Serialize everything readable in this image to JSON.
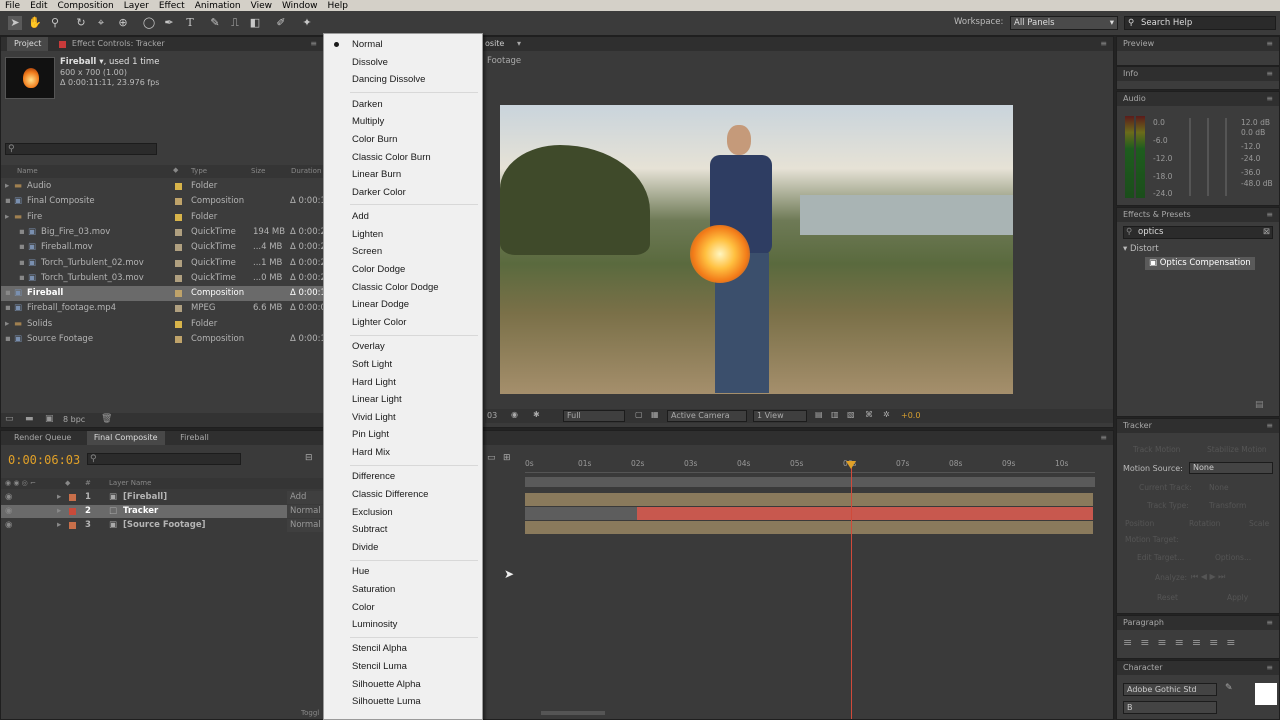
{
  "menubar": {
    "items": [
      "File",
      "Edit",
      "Composition",
      "Layer",
      "Effect",
      "Animation",
      "View",
      "Window",
      "Help"
    ]
  },
  "toolbar": {
    "workspace_label": "Workspace:",
    "workspace_value": "All Panels",
    "search_placeholder": "Search Help"
  },
  "project": {
    "tabs": [
      "Project",
      "Effect Controls: Tracker"
    ],
    "item_name": "Fireball ▾",
    "item_used": ", used 1 time",
    "item_dims": "600 x 700 (1.00)",
    "item_duration": "Δ 0:00:11:11, 23.976 fps",
    "columns": [
      "Name",
      "Type",
      "Size",
      "Duration"
    ],
    "bpc": "8 bpc",
    "rows": [
      {
        "name": "Audio",
        "type": "Folder",
        "size": "",
        "dur": "",
        "color": "#d8b44a",
        "indent": 0
      },
      {
        "name": "Final Composite",
        "type": "Composition",
        "size": "",
        "dur": "Δ 0:00:1",
        "color": "#bfa36a",
        "indent": 0
      },
      {
        "name": "Fire",
        "type": "Folder",
        "size": "",
        "dur": "",
        "color": "#d8b44a",
        "indent": 0
      },
      {
        "name": "Big_Fire_03.mov",
        "type": "QuickTime",
        "size": "194 MB",
        "dur": "Δ 0:00:2",
        "color": "#b0a080",
        "indent": 1
      },
      {
        "name": "Fireball.mov",
        "type": "QuickTime",
        "size": "...4 MB",
        "dur": "Δ 0:00:2",
        "color": "#b0a080",
        "indent": 1
      },
      {
        "name": "Torch_Turbulent_02.mov",
        "type": "QuickTime",
        "size": "...1 MB",
        "dur": "Δ 0:00:2",
        "color": "#b0a080",
        "indent": 1
      },
      {
        "name": "Torch_Turbulent_03.mov",
        "type": "QuickTime",
        "size": "...0 MB",
        "dur": "Δ 0:00:2",
        "color": "#b0a080",
        "indent": 1
      },
      {
        "name": "Fireball",
        "type": "Composition",
        "size": "",
        "dur": "Δ 0:00:1",
        "color": "#bfa36a",
        "indent": 0
      },
      {
        "name": "Fireball_footage.mp4",
        "type": "MPEG",
        "size": "6.6 MB",
        "dur": "Δ 0:00:0",
        "color": "#b0a080",
        "indent": 0
      },
      {
        "name": "Solids",
        "type": "Folder",
        "size": "",
        "dur": "",
        "color": "#d8b44a",
        "indent": 0
      },
      {
        "name": "Source Footage",
        "type": "Composition",
        "size": "",
        "dur": "Δ 0:00:1",
        "color": "#bfa36a",
        "indent": 0
      }
    ]
  },
  "composition": {
    "tab": "osite",
    "breadcrumb": "Footage",
    "res": "Full",
    "camera": "Active Camera",
    "views": "1 View",
    "exposure": "+0.0",
    "timecode_small": "03"
  },
  "timeline": {
    "tabs": [
      "Render Queue",
      "Final Composite",
      "Fireball"
    ],
    "timecode": "0:00:06:03",
    "col_layer_name": "Layer Name",
    "ruler": [
      "0s",
      "01s",
      "02s",
      "03s",
      "04s",
      "05s",
      "06s",
      "07s",
      "08s",
      "09s",
      "10s"
    ],
    "layers": [
      {
        "num": "1",
        "name": "[Fireball]",
        "mode": "Add",
        "color": "#c86f4a"
      },
      {
        "num": "2",
        "name": "Tracker",
        "mode": "Normal",
        "color": "#c84a3a"
      },
      {
        "num": "3",
        "name": "[Source Footage]",
        "mode": "Normal",
        "color": "#c86f4a"
      }
    ],
    "bottom_label": "Toggl"
  },
  "menu": {
    "groups": [
      [
        "Normal",
        "Dissolve",
        "Dancing Dissolve"
      ],
      [
        "Darken",
        "Multiply",
        "Color Burn",
        "Classic Color Burn",
        "Linear Burn",
        "Darker Color"
      ],
      [
        "Add",
        "Lighten",
        "Screen",
        "Color Dodge",
        "Classic Color Dodge",
        "Linear Dodge",
        "Lighter Color"
      ],
      [
        "Overlay",
        "Soft Light",
        "Hard Light",
        "Linear Light",
        "Vivid Light",
        "Pin Light",
        "Hard Mix"
      ],
      [
        "Difference",
        "Classic Difference",
        "Exclusion",
        "Subtract",
        "Divide"
      ],
      [
        "Hue",
        "Saturation",
        "Color",
        "Luminosity"
      ],
      [
        "Stencil Alpha",
        "Stencil Luma",
        "Silhouette Alpha",
        "Silhouette Luma"
      ]
    ],
    "selected": "Normal"
  },
  "right": {
    "preview_title": "Preview",
    "info_title": "Info",
    "audio_title": "Audio",
    "audio_left": [
      "0.0",
      "-6.0",
      "-12.0",
      "-18.0",
      "-24.0"
    ],
    "audio_right": [
      "12.0 dB",
      "0.0 dB",
      "-12.0",
      "-24.0",
      "-36.0",
      "-48.0 dB"
    ],
    "effects_title": "Effects & Presets",
    "effects_search": "optics",
    "effects_category": "Distort",
    "effects_item": "Optics Compensation",
    "tracker_title": "Tracker",
    "tracker_buttons": [
      "Track Motion",
      "Stabilize Motion"
    ],
    "motion_source_label": "Motion Source:",
    "motion_source_value": "None",
    "current_track_label": "Current Track:",
    "current_track_value": "None",
    "track_type_label": "Track Type:",
    "track_type_value": "Transform",
    "checks": [
      "Position",
      "Rotation",
      "Scale"
    ],
    "motion_target": "Motion Target:",
    "edit_target": "Edit Target...",
    "options": "Options...",
    "analyze": "Analyze:",
    "reset": "Reset",
    "apply": "Apply",
    "paragraph_title": "Paragraph",
    "character_title": "Character",
    "font_name": "Adobe Gothic Std",
    "font_style": "B"
  }
}
